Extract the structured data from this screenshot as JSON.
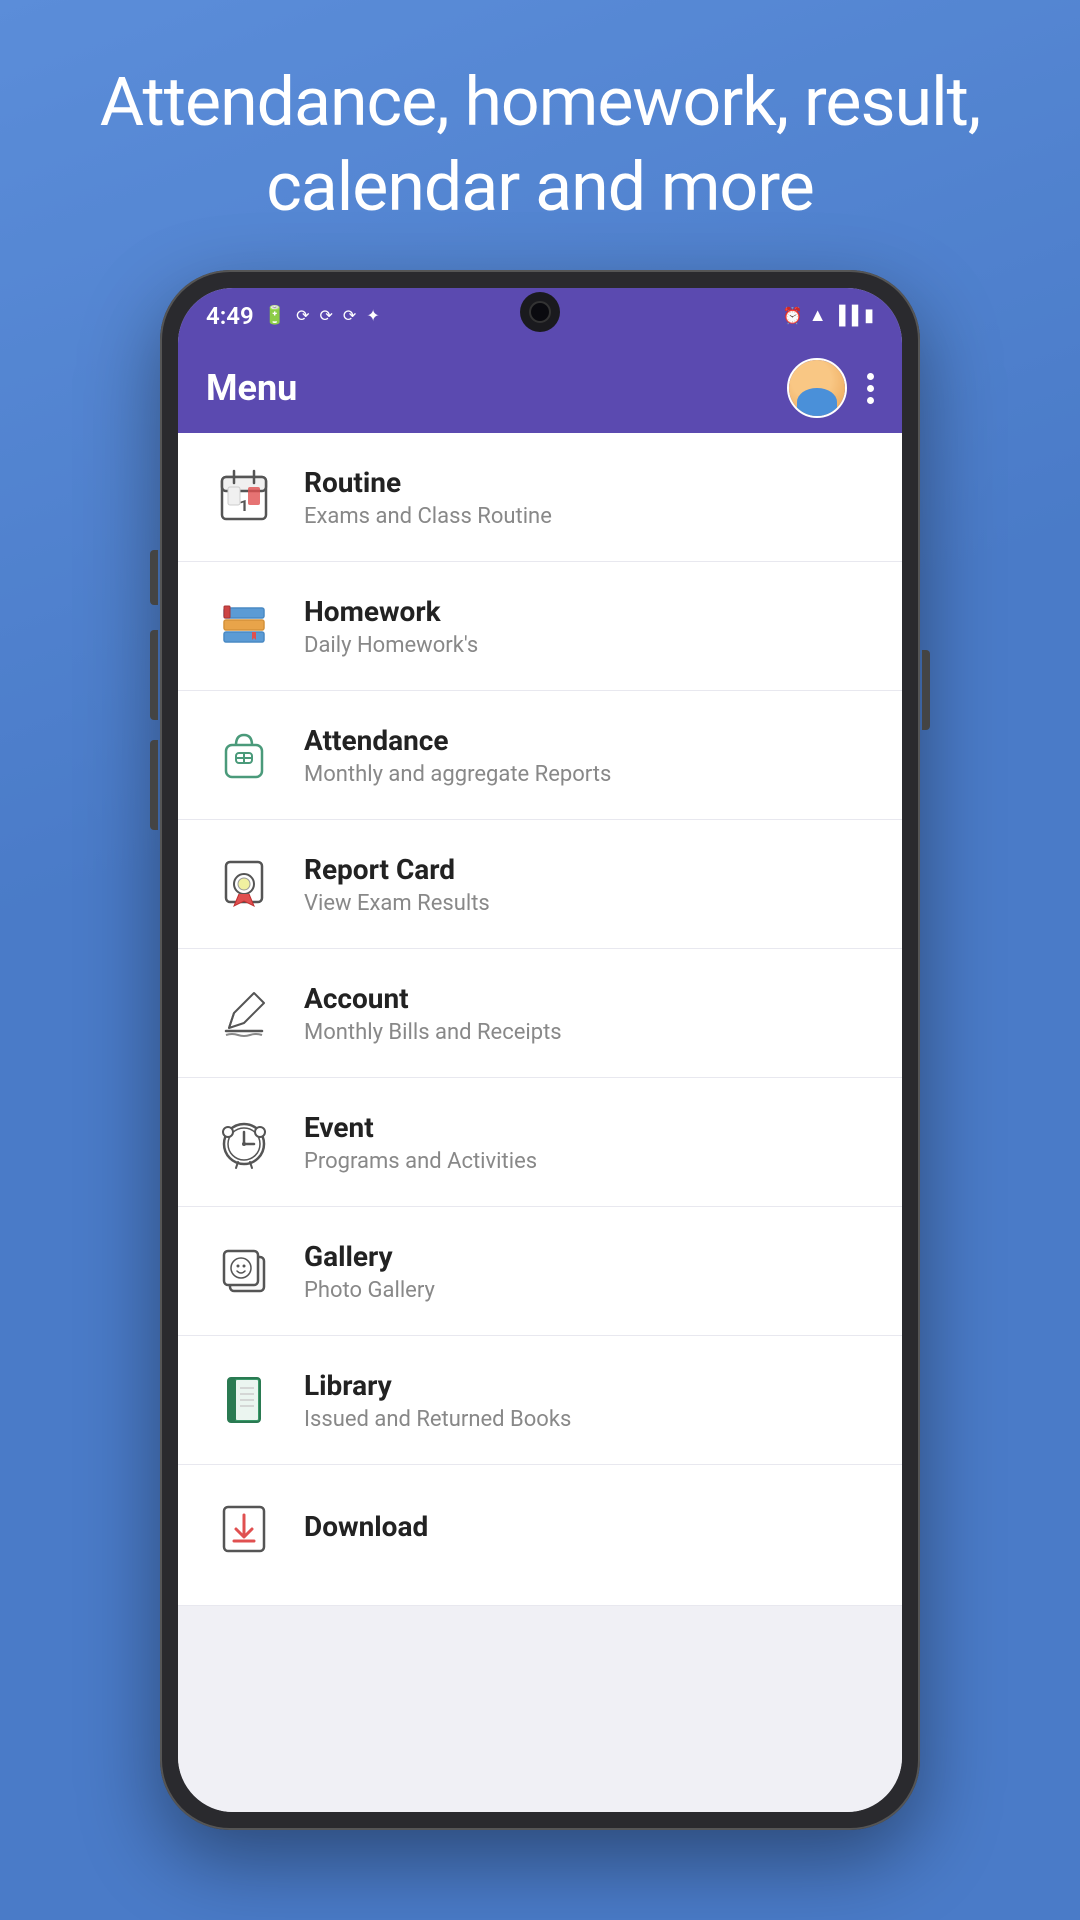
{
  "hero": {
    "text": "Attendance, homework, result, calendar and more"
  },
  "status_bar": {
    "time": "4:49",
    "icons": [
      "battery",
      "signal",
      "wifi",
      "alarm"
    ]
  },
  "app_bar": {
    "title": "Menu",
    "more_options_label": "More options"
  },
  "menu_items": [
    {
      "id": "routine",
      "title": "Routine",
      "subtitle": "Exams and Class Routine",
      "icon": "calendar-icon"
    },
    {
      "id": "homework",
      "title": "Homework",
      "subtitle": "Daily Homework's",
      "icon": "books-icon"
    },
    {
      "id": "attendance",
      "title": "Attendance",
      "subtitle": "Monthly and aggregate Reports",
      "icon": "bag-icon"
    },
    {
      "id": "report-card",
      "title": "Report Card",
      "subtitle": "View Exam Results",
      "icon": "certificate-icon"
    },
    {
      "id": "account",
      "title": "Account",
      "subtitle": "Monthly Bills and Receipts",
      "icon": "pen-icon"
    },
    {
      "id": "event",
      "title": "Event",
      "subtitle": "Programs and Activities",
      "icon": "clock-icon"
    },
    {
      "id": "gallery",
      "title": "Gallery",
      "subtitle": "Photo Gallery",
      "icon": "gallery-icon"
    },
    {
      "id": "library",
      "title": "Library",
      "subtitle": "Issued and Returned Books",
      "icon": "library-icon"
    },
    {
      "id": "download",
      "title": "Download",
      "subtitle": "",
      "icon": "download-icon"
    }
  ]
}
